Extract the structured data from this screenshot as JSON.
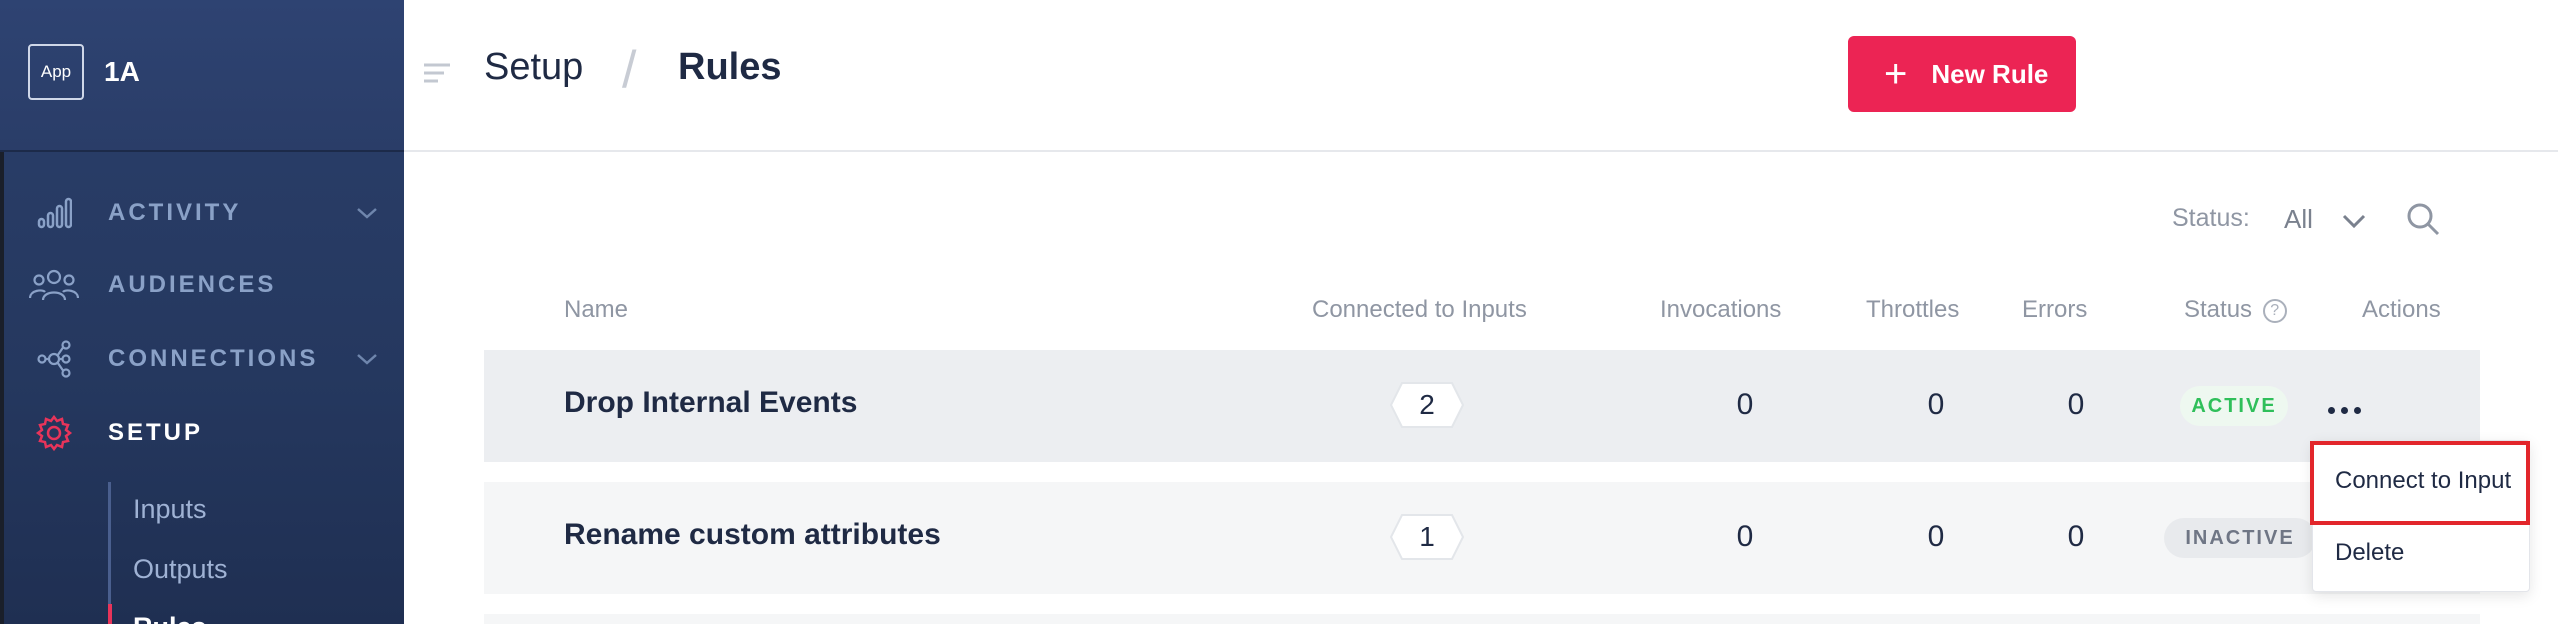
{
  "sidebar": {
    "logo_text": "App",
    "workspace": "1A",
    "nav": [
      {
        "label": "ACTIVITY",
        "icon": "bar-chart-icon"
      },
      {
        "label": "AUDIENCES",
        "icon": "users-icon"
      },
      {
        "label": "CONNECTIONS",
        "icon": "connections-icon"
      },
      {
        "label": "SETUP",
        "icon": "gear-icon"
      }
    ],
    "sub_items": [
      "Inputs",
      "Outputs",
      "Rules"
    ]
  },
  "header": {
    "breadcrumb_parent": "Setup",
    "breadcrumb_separator": "/",
    "breadcrumb_current": "Rules",
    "new_rule_plus": "+",
    "new_rule_label": "New Rule"
  },
  "filter": {
    "status_label": "Status:",
    "status_value": "All"
  },
  "table": {
    "columns": [
      "Name",
      "Connected to Inputs",
      "Invocations",
      "Throttles",
      "Errors",
      "Status",
      "Actions"
    ],
    "status_help": "?",
    "rows": [
      {
        "name": "Drop Internal Events",
        "connected": "2",
        "invocations": "0",
        "throttles": "0",
        "errors": "0",
        "status": "ACTIVE"
      },
      {
        "name": "Rename custom attributes",
        "connected": "1",
        "invocations": "0",
        "throttles": "0",
        "errors": "0",
        "status": "INACTIVE"
      }
    ]
  },
  "dropdown": {
    "items": [
      "Connect to Input",
      "Delete"
    ]
  },
  "colors": {
    "accent": "#ec2454",
    "sidebar": "#25385f",
    "active_status": "#2fbf5a",
    "highlight": "#e2262b"
  }
}
